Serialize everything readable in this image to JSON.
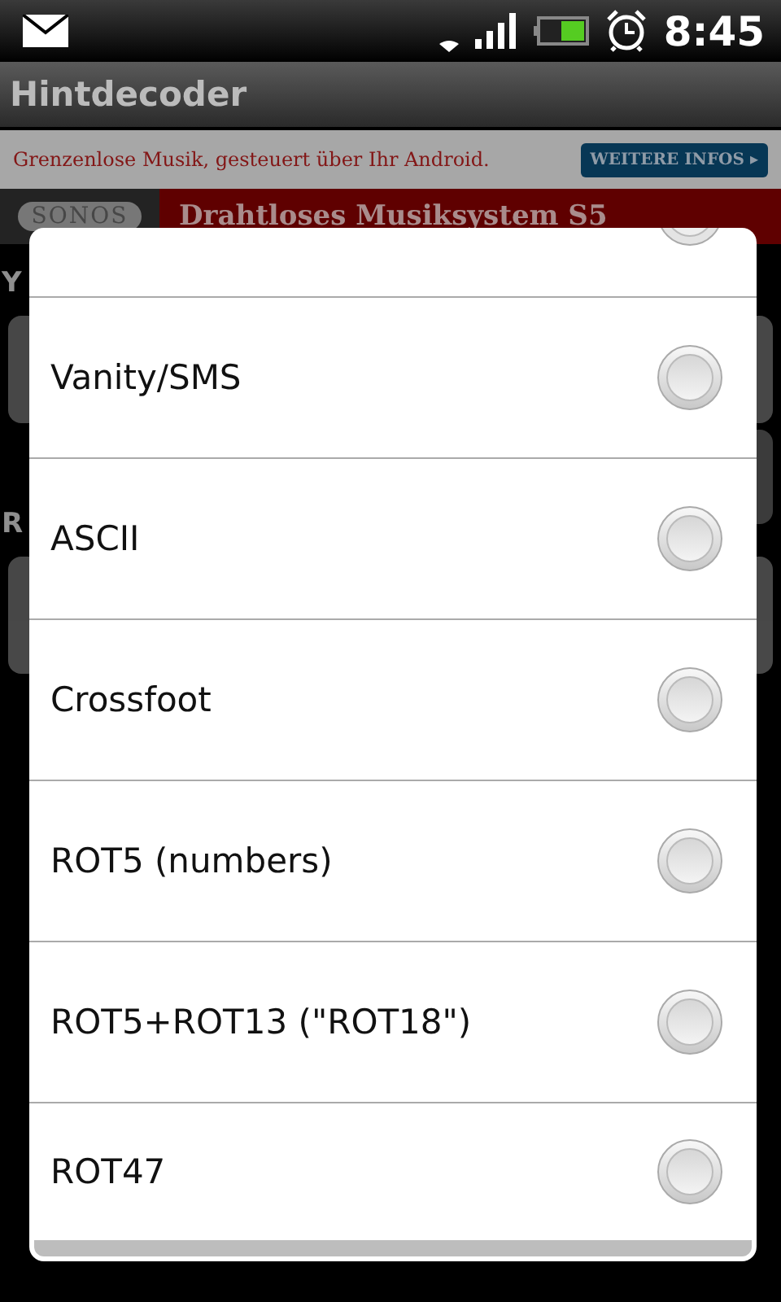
{
  "status_bar": {
    "time": "8:45"
  },
  "app_bar": {
    "title": "Hintdecoder"
  },
  "ad": {
    "slogan": "Grenzenlose Musik, gesteuert über Ihr Android.",
    "button": "WEITERE INFOS",
    "button_arrow": "▸",
    "logo": "SONOS",
    "headline": "Drahtloses Musiksystem S5"
  },
  "background": {
    "label_1": "Y",
    "label_2": "R"
  },
  "dialog": {
    "options": [
      {
        "label": "Vanity/SMS",
        "selected": false
      },
      {
        "label": "ASCII",
        "selected": false
      },
      {
        "label": "Crossfoot",
        "selected": false
      },
      {
        "label": "ROT5 (numbers)",
        "selected": false
      },
      {
        "label": "ROT5+ROT13 (\"ROT18\")",
        "selected": false
      },
      {
        "label": "ROT47",
        "selected": false
      }
    ]
  }
}
